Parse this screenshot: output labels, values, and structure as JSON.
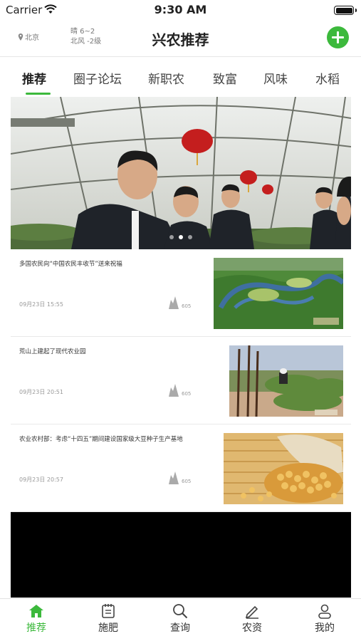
{
  "status_bar": {
    "carrier": "Carrier",
    "time": "9:30 AM"
  },
  "header": {
    "location": "北京",
    "weather_line1": "晴 6~2",
    "weather_line2": "北风 -2级",
    "title": "兴农推荐"
  },
  "tabs": [
    {
      "label": "推荐",
      "active": true
    },
    {
      "label": "圈子论坛"
    },
    {
      "label": "新职农"
    },
    {
      "label": "致富"
    },
    {
      "label": "风味"
    },
    {
      "label": "水稻"
    }
  ],
  "banner": {
    "slide_count": 3,
    "active_slide": 2
  },
  "news": [
    {
      "title": "多国农民向“中国农民丰收节”送来祝福",
      "date": "09月23日 15:55",
      "views": "605"
    },
    {
      "title": "荒山上建起了现代农业园",
      "date": "09月23日 20:51",
      "views": "605"
    },
    {
      "title": "农业农村部：考虑“十四五”期间建设国家级大豆种子生产基地",
      "date": "09月23日 20:57",
      "views": "605"
    }
  ],
  "tabbar": [
    {
      "label": "推荐",
      "icon": "home-icon",
      "active": true
    },
    {
      "label": "施肥",
      "icon": "notepad-icon"
    },
    {
      "label": "查询",
      "icon": "search-icon"
    },
    {
      "label": "农资",
      "icon": "pen-icon"
    },
    {
      "label": "我的",
      "icon": "user-icon"
    }
  ],
  "colors": {
    "accent": "#3cb93c"
  }
}
